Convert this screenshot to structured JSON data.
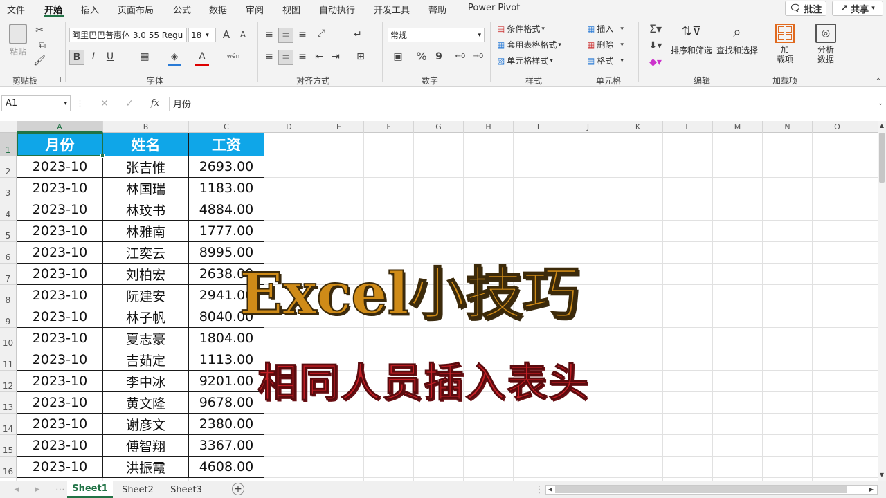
{
  "menu": {
    "items": [
      "文件",
      "开始",
      "插入",
      "页面布局",
      "公式",
      "数据",
      "审阅",
      "视图",
      "自动执行",
      "开发工具",
      "帮助",
      "Power Pivot"
    ],
    "active": "开始",
    "comment_label": "批注",
    "share_label": "共享"
  },
  "ribbon": {
    "clipboard": {
      "paste_label": "粘贴",
      "group_label": "剪贴板"
    },
    "font": {
      "font_name": "阿里巴巴普惠体 3.0 55 Regu",
      "font_size": "18",
      "bold": "B",
      "italic": "I",
      "underline": "U",
      "grow": "A",
      "shrink": "A",
      "wen": "wén",
      "group_label": "字体"
    },
    "alignment": {
      "group_label": "对齐方式"
    },
    "number": {
      "format": "常规",
      "percent": "%",
      "comma": "9",
      "group_label": "数字"
    },
    "styles": {
      "conditional": "条件格式",
      "table": "套用表格格式",
      "cell_styles": "单元格样式",
      "group_label": "样式"
    },
    "cells": {
      "insert": "插入",
      "delete": "删除",
      "format": "格式",
      "group_label": "单元格"
    },
    "editing": {
      "sort_filter": "排序和筛选",
      "find_select": "查找和选择",
      "group_label": "编辑"
    },
    "addins": {
      "label_line1": "加",
      "label_line2": "载项",
      "group_label": "加载项"
    },
    "analysis": {
      "label_line1": "分析",
      "label_line2": "数据"
    }
  },
  "formula_bar": {
    "name_box": "A1",
    "fx": "fx",
    "content": "月份"
  },
  "grid": {
    "columns": [
      "A",
      "B",
      "C",
      "D",
      "E",
      "F",
      "G",
      "H",
      "I",
      "J",
      "K",
      "L",
      "M",
      "N",
      "O"
    ],
    "row_numbers": [
      "1",
      "2",
      "3",
      "4",
      "5",
      "6",
      "7",
      "8",
      "9",
      "10",
      "11",
      "12",
      "13",
      "14",
      "15",
      "16"
    ],
    "header": [
      "月份",
      "姓名",
      "工资"
    ],
    "rows": [
      [
        "2023-10",
        "张吉惟",
        "2693.00"
      ],
      [
        "2023-10",
        "林国瑞",
        "1183.00"
      ],
      [
        "2023-10",
        "林玟书",
        "4884.00"
      ],
      [
        "2023-10",
        "林雅南",
        "1777.00"
      ],
      [
        "2023-10",
        "江奕云",
        "8995.00"
      ],
      [
        "2023-10",
        "刘柏宏",
        "2638.00"
      ],
      [
        "2023-10",
        "阮建安",
        "2941.00"
      ],
      [
        "2023-10",
        "林子帆",
        "8040.00"
      ],
      [
        "2023-10",
        "夏志豪",
        "1804.00"
      ],
      [
        "2023-10",
        "吉茹定",
        "1113.00"
      ],
      [
        "2023-10",
        "李中冰",
        "9201.00"
      ],
      [
        "2023-10",
        "黄文隆",
        "9678.00"
      ],
      [
        "2023-10",
        "谢彦文",
        "2380.00"
      ],
      [
        "2023-10",
        "傅智翔",
        "3367.00"
      ],
      [
        "2023-10",
        "洪振霞",
        "4608.00"
      ]
    ]
  },
  "overlay": {
    "title": "Excel小技巧",
    "subtitle": "相同人员插入表头"
  },
  "sheets": [
    "Sheet1",
    "Sheet2",
    "Sheet3"
  ],
  "colors": {
    "accent": "#217346",
    "header_fill": "#0fa6e8",
    "title": "#cf8b18",
    "subtitle": "#c41e25"
  }
}
